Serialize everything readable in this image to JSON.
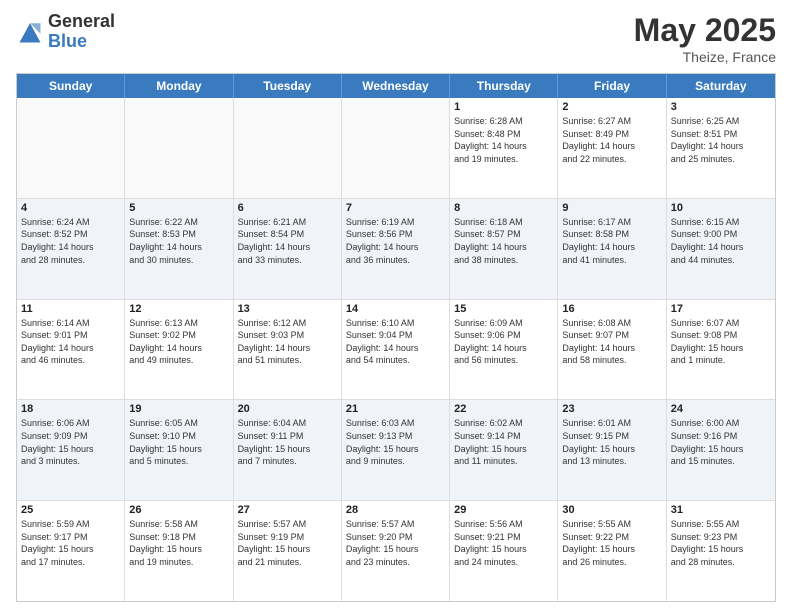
{
  "header": {
    "logo_general": "General",
    "logo_blue": "Blue",
    "title": "May 2025",
    "location": "Theize, France"
  },
  "days_of_week": [
    "Sunday",
    "Monday",
    "Tuesday",
    "Wednesday",
    "Thursday",
    "Friday",
    "Saturday"
  ],
  "weeks": [
    [
      {
        "day": "",
        "info": "",
        "empty": true
      },
      {
        "day": "",
        "info": "",
        "empty": true
      },
      {
        "day": "",
        "info": "",
        "empty": true
      },
      {
        "day": "",
        "info": "",
        "empty": true
      },
      {
        "day": "1",
        "info": "Sunrise: 6:28 AM\nSunset: 8:48 PM\nDaylight: 14 hours\nand 19 minutes."
      },
      {
        "day": "2",
        "info": "Sunrise: 6:27 AM\nSunset: 8:49 PM\nDaylight: 14 hours\nand 22 minutes."
      },
      {
        "day": "3",
        "info": "Sunrise: 6:25 AM\nSunset: 8:51 PM\nDaylight: 14 hours\nand 25 minutes."
      }
    ],
    [
      {
        "day": "4",
        "info": "Sunrise: 6:24 AM\nSunset: 8:52 PM\nDaylight: 14 hours\nand 28 minutes."
      },
      {
        "day": "5",
        "info": "Sunrise: 6:22 AM\nSunset: 8:53 PM\nDaylight: 14 hours\nand 30 minutes."
      },
      {
        "day": "6",
        "info": "Sunrise: 6:21 AM\nSunset: 8:54 PM\nDaylight: 14 hours\nand 33 minutes."
      },
      {
        "day": "7",
        "info": "Sunrise: 6:19 AM\nSunset: 8:56 PM\nDaylight: 14 hours\nand 36 minutes."
      },
      {
        "day": "8",
        "info": "Sunrise: 6:18 AM\nSunset: 8:57 PM\nDaylight: 14 hours\nand 38 minutes."
      },
      {
        "day": "9",
        "info": "Sunrise: 6:17 AM\nSunset: 8:58 PM\nDaylight: 14 hours\nand 41 minutes."
      },
      {
        "day": "10",
        "info": "Sunrise: 6:15 AM\nSunset: 9:00 PM\nDaylight: 14 hours\nand 44 minutes."
      }
    ],
    [
      {
        "day": "11",
        "info": "Sunrise: 6:14 AM\nSunset: 9:01 PM\nDaylight: 14 hours\nand 46 minutes."
      },
      {
        "day": "12",
        "info": "Sunrise: 6:13 AM\nSunset: 9:02 PM\nDaylight: 14 hours\nand 49 minutes."
      },
      {
        "day": "13",
        "info": "Sunrise: 6:12 AM\nSunset: 9:03 PM\nDaylight: 14 hours\nand 51 minutes."
      },
      {
        "day": "14",
        "info": "Sunrise: 6:10 AM\nSunset: 9:04 PM\nDaylight: 14 hours\nand 54 minutes."
      },
      {
        "day": "15",
        "info": "Sunrise: 6:09 AM\nSunset: 9:06 PM\nDaylight: 14 hours\nand 56 minutes."
      },
      {
        "day": "16",
        "info": "Sunrise: 6:08 AM\nSunset: 9:07 PM\nDaylight: 14 hours\nand 58 minutes."
      },
      {
        "day": "17",
        "info": "Sunrise: 6:07 AM\nSunset: 9:08 PM\nDaylight: 15 hours\nand 1 minute."
      }
    ],
    [
      {
        "day": "18",
        "info": "Sunrise: 6:06 AM\nSunset: 9:09 PM\nDaylight: 15 hours\nand 3 minutes."
      },
      {
        "day": "19",
        "info": "Sunrise: 6:05 AM\nSunset: 9:10 PM\nDaylight: 15 hours\nand 5 minutes."
      },
      {
        "day": "20",
        "info": "Sunrise: 6:04 AM\nSunset: 9:11 PM\nDaylight: 15 hours\nand 7 minutes."
      },
      {
        "day": "21",
        "info": "Sunrise: 6:03 AM\nSunset: 9:13 PM\nDaylight: 15 hours\nand 9 minutes."
      },
      {
        "day": "22",
        "info": "Sunrise: 6:02 AM\nSunset: 9:14 PM\nDaylight: 15 hours\nand 11 minutes."
      },
      {
        "day": "23",
        "info": "Sunrise: 6:01 AM\nSunset: 9:15 PM\nDaylight: 15 hours\nand 13 minutes."
      },
      {
        "day": "24",
        "info": "Sunrise: 6:00 AM\nSunset: 9:16 PM\nDaylight: 15 hours\nand 15 minutes."
      }
    ],
    [
      {
        "day": "25",
        "info": "Sunrise: 5:59 AM\nSunset: 9:17 PM\nDaylight: 15 hours\nand 17 minutes."
      },
      {
        "day": "26",
        "info": "Sunrise: 5:58 AM\nSunset: 9:18 PM\nDaylight: 15 hours\nand 19 minutes."
      },
      {
        "day": "27",
        "info": "Sunrise: 5:57 AM\nSunset: 9:19 PM\nDaylight: 15 hours\nand 21 minutes."
      },
      {
        "day": "28",
        "info": "Sunrise: 5:57 AM\nSunset: 9:20 PM\nDaylight: 15 hours\nand 23 minutes."
      },
      {
        "day": "29",
        "info": "Sunrise: 5:56 AM\nSunset: 9:21 PM\nDaylight: 15 hours\nand 24 minutes."
      },
      {
        "day": "30",
        "info": "Sunrise: 5:55 AM\nSunset: 9:22 PM\nDaylight: 15 hours\nand 26 minutes."
      },
      {
        "day": "31",
        "info": "Sunrise: 5:55 AM\nSunset: 9:23 PM\nDaylight: 15 hours\nand 28 minutes."
      }
    ]
  ]
}
